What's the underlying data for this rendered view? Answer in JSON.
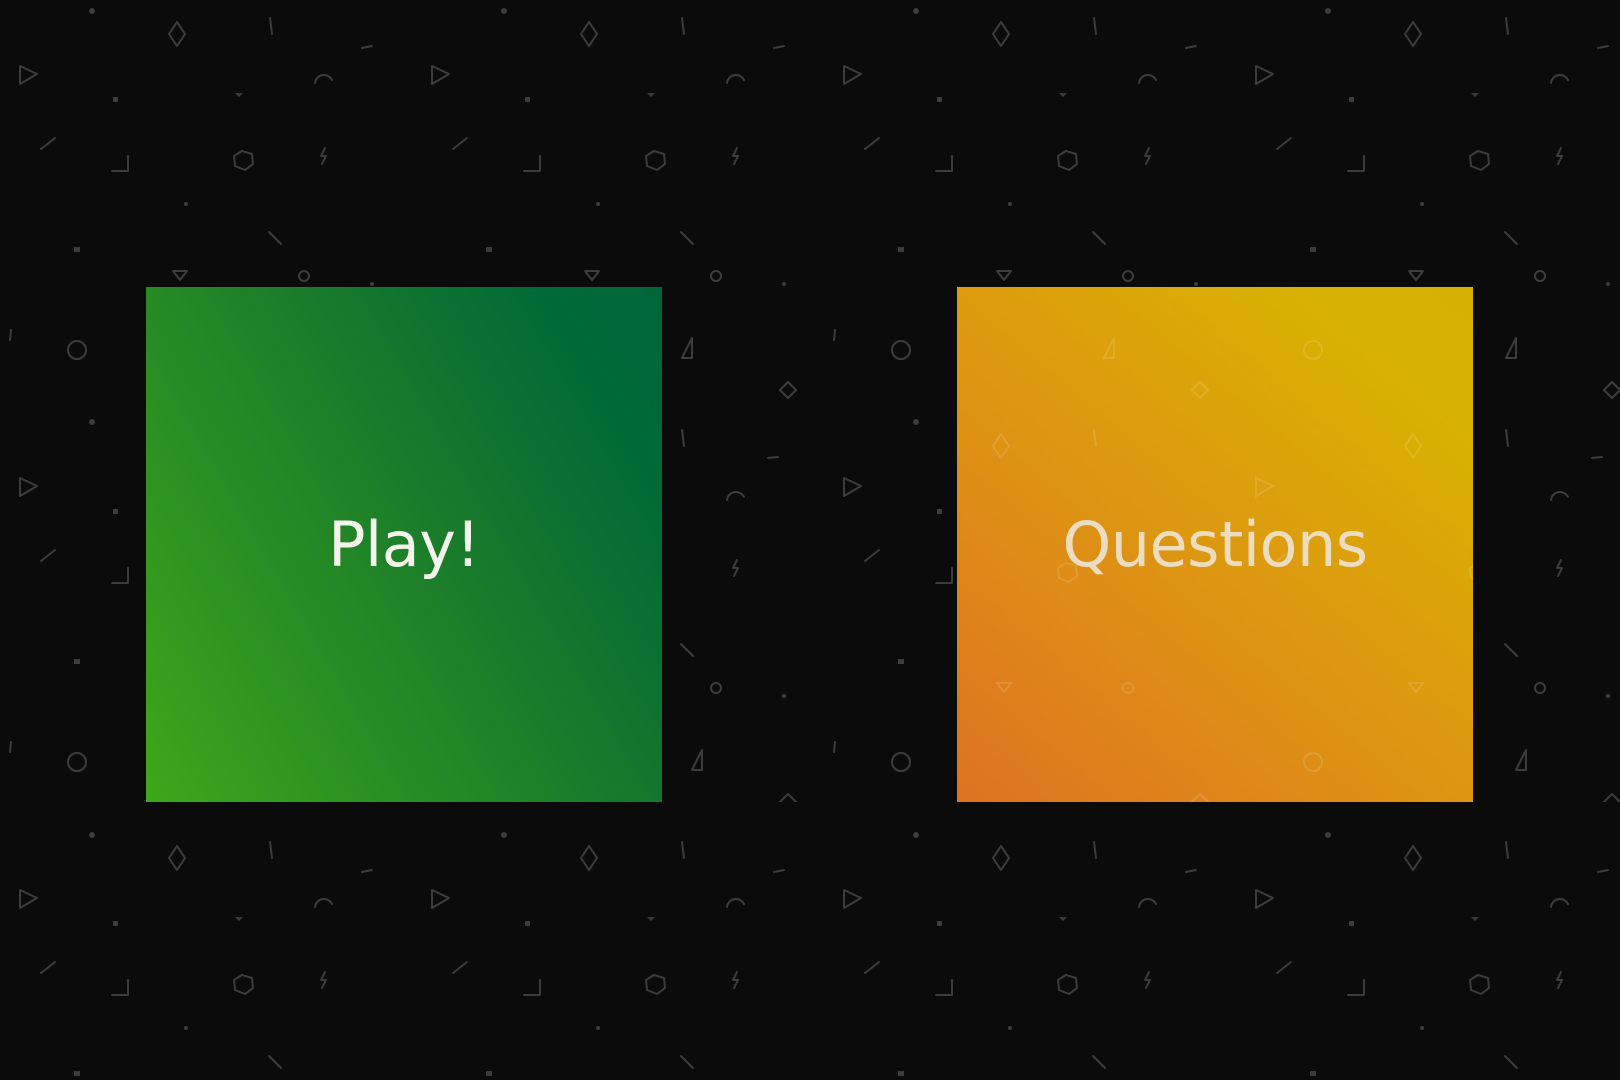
{
  "menu": {
    "play_label": "Play!",
    "questions_label": "Questions"
  },
  "colors": {
    "background": "#0b0b0b",
    "pattern": "#3a3a3a",
    "play_gradient": [
      "#3fa71a",
      "#00663a"
    ],
    "questions_gradient": [
      "#dd7222",
      "#d6b100"
    ]
  },
  "background_pattern_icons": [
    "diamond-icon",
    "triangle-icon",
    "circle-icon",
    "hexagon-icon",
    "lightning-icon",
    "arc-icon",
    "square-icon",
    "line-icon",
    "corner-icon",
    "dot-icon"
  ]
}
